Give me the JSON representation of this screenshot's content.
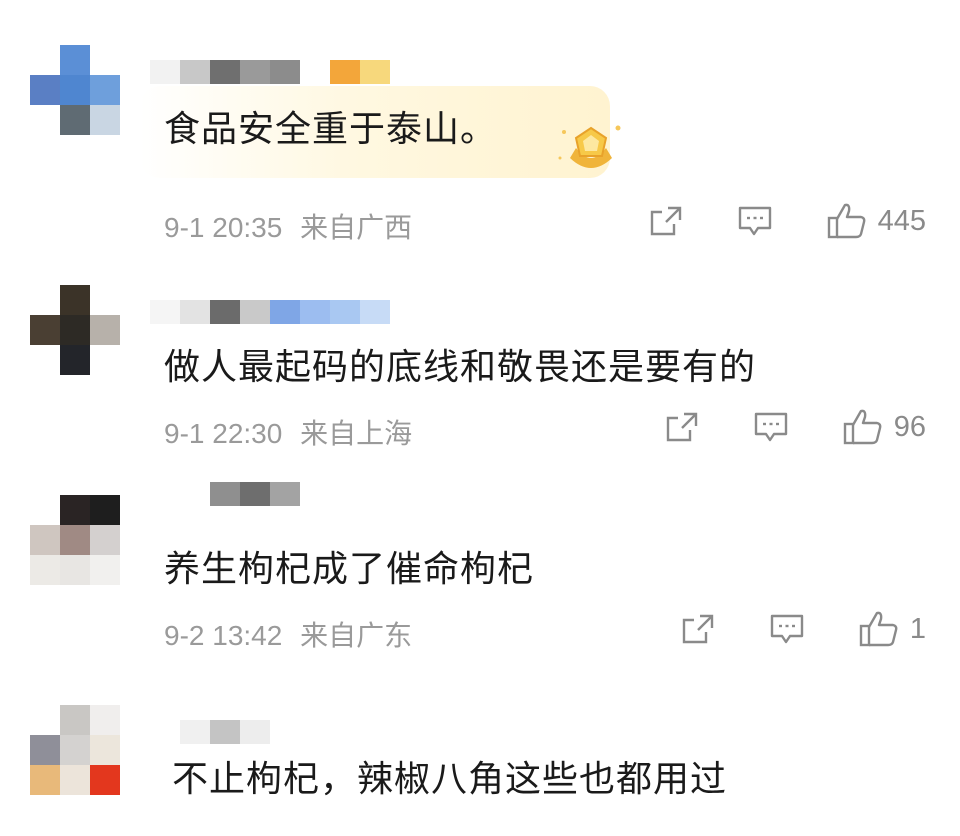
{
  "comments": [
    {
      "text": "食品安全重于泰山。",
      "time": "9-1 20:35",
      "location": "来自广西",
      "likes": "445",
      "avatar_colors": [
        "#ffffff",
        "#5b8fd6",
        "#ffffff",
        "#5a7fc4",
        "#4f86d0",
        "#6e9fdc",
        "#ffffff",
        "#5f6b73",
        "#c9d6e3"
      ],
      "name_colors": [
        "#f2f2f2",
        "#c8c8c8",
        "#6f6f6f",
        "#9a9a9a",
        "#8c8c8c",
        "#ffffff",
        "#f3a63a",
        "#f7d87c"
      ]
    },
    {
      "text": "做人最起码的底线和敬畏还是要有的",
      "time": "9-1 22:30",
      "location": "来自上海",
      "likes": "96",
      "avatar_colors": [
        "#ffffff",
        "#3b3328",
        "#ffffff",
        "#4a3f33",
        "#2d2a25",
        "#b7b1aa",
        "#ffffff",
        "#23252a",
        "#ffffff"
      ],
      "name_colors": [
        "#f5f5f5",
        "#e3e3e3",
        "#6b6b6b",
        "#c9c9c9",
        "#7fa6e6",
        "#9cbdf0",
        "#a9c8f2",
        "#c7dbf6"
      ]
    },
    {
      "text": "养生枸杞成了催命枸杞",
      "time": "9-2 13:42",
      "location": "来自广东",
      "likes": "1",
      "avatar_colors": [
        "#ffffff",
        "#2a2424",
        "#1e1e1e",
        "#cfc6c0",
        "#a08a84",
        "#d4d0cf",
        "#eceae6",
        "#e8e6e3",
        "#f1f0ee"
      ],
      "name_colors": [
        "#ffffff",
        "#ffffff",
        "#8f8f8f",
        "#6e6e6e",
        "#a3a3a3",
        "#ffffff",
        "#ffffff",
        "#ffffff"
      ]
    },
    {
      "text": "不止枸杞，辣椒八角这些也都用过",
      "avatar_colors": [
        "#ffffff",
        "#c9c7c4",
        "#f0eeed",
        "#8f8f99",
        "#d4d2d0",
        "#ece6dc",
        "#e8b97a",
        "#ece4da",
        "#e3371e"
      ],
      "name_colors": [
        "#ffffff",
        "#f0f0f0",
        "#c4c4c4",
        "#ededed",
        "#ffffff",
        "#ffffff",
        "#ffffff",
        "#ffffff"
      ]
    }
  ],
  "icons": {
    "share": "share-icon",
    "reply": "comment-icon",
    "like": "thumbs-up-icon"
  }
}
